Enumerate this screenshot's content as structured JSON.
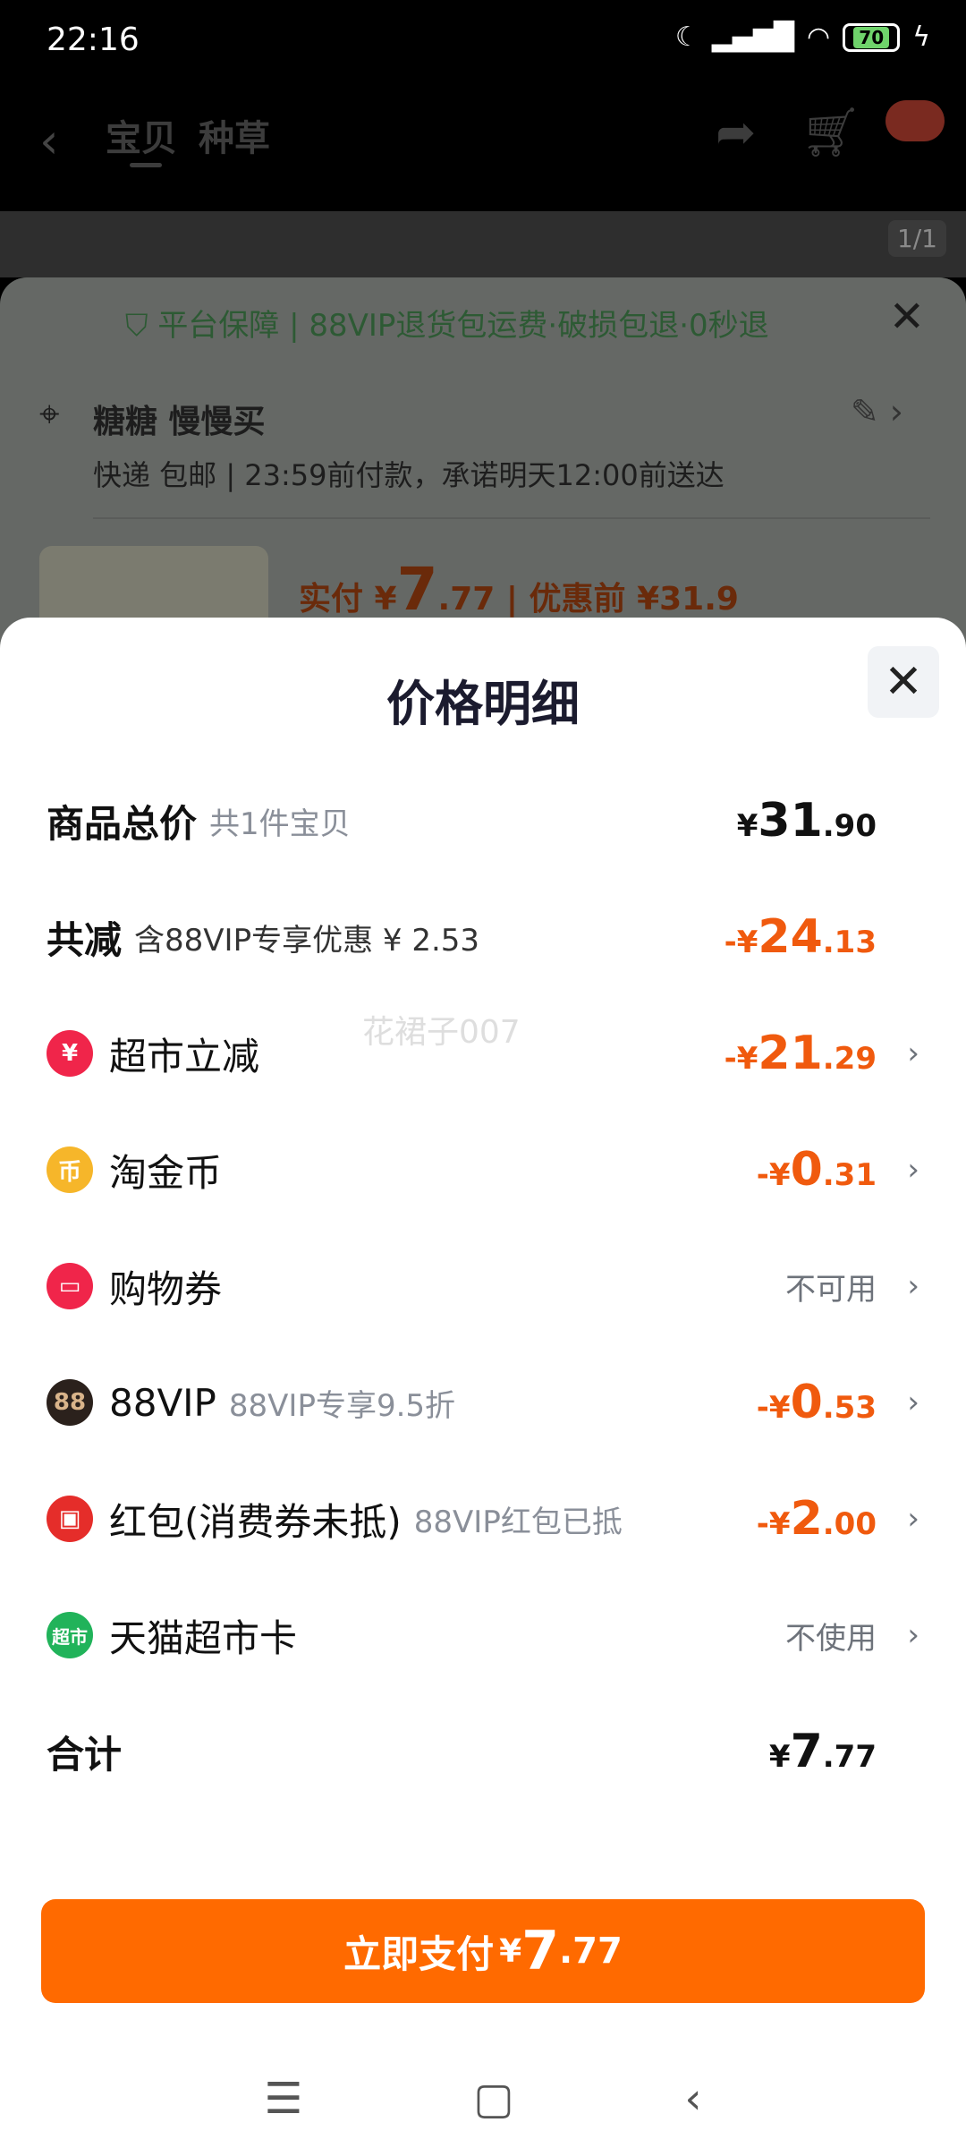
{
  "status_bar": {
    "time": "22:16",
    "battery": "70"
  },
  "top_nav": {
    "tabs": [
      "宝贝",
      "种草"
    ]
  },
  "gallery": {
    "page_indicator": "1/1"
  },
  "order": {
    "guarantee": "平台保障 | 88VIP退货包运费·破损包退·0秒退",
    "address_name": "糖糖 慢慢买",
    "shipping": "快递 包邮 | 23:59前付款，承诺明天12:00前送达",
    "paid_prefix": "实付 ¥",
    "paid_int": "7",
    "paid_dec": ".77",
    "before_discount": "| 优惠前 ¥31.9"
  },
  "sheet": {
    "title": "价格明细",
    "rows": [
      {
        "label": "商品总价",
        "sub": "共1件宝贝",
        "cur": "¥",
        "int": "31",
        "dec": ".90"
      },
      {
        "label": "共减",
        "sub": "含88VIP专享优惠 ¥ 2.53",
        "cur": "-¥",
        "int": "24",
        "dec": ".13"
      },
      {
        "label": "超市立减",
        "cur": "-¥",
        "int": "21",
        "dec": ".29"
      },
      {
        "label": "淘金币",
        "cur": "-¥",
        "int": "0",
        "dec": ".31"
      },
      {
        "label": "购物券",
        "status": "不可用"
      },
      {
        "label": "88VIP",
        "sub": "88VIP专享9.5折",
        "cur": "-¥",
        "int": "0",
        "dec": ".53"
      },
      {
        "label": "红包(消费券未抵)",
        "sub": "88VIP红包已抵",
        "cur": "-¥",
        "int": "2",
        "dec": ".00"
      },
      {
        "label": "天猫超市卡",
        "status": "不使用"
      },
      {
        "label": "合计",
        "cur": "¥",
        "int": "7",
        "dec": ".77"
      }
    ],
    "watermark": "花裙子007"
  },
  "pay_button": {
    "label": "立即支付",
    "cur": "¥",
    "int": "7",
    "dec": ".77"
  },
  "colors": {
    "accent": "#ff6a00",
    "discount": "#f05a0e"
  }
}
